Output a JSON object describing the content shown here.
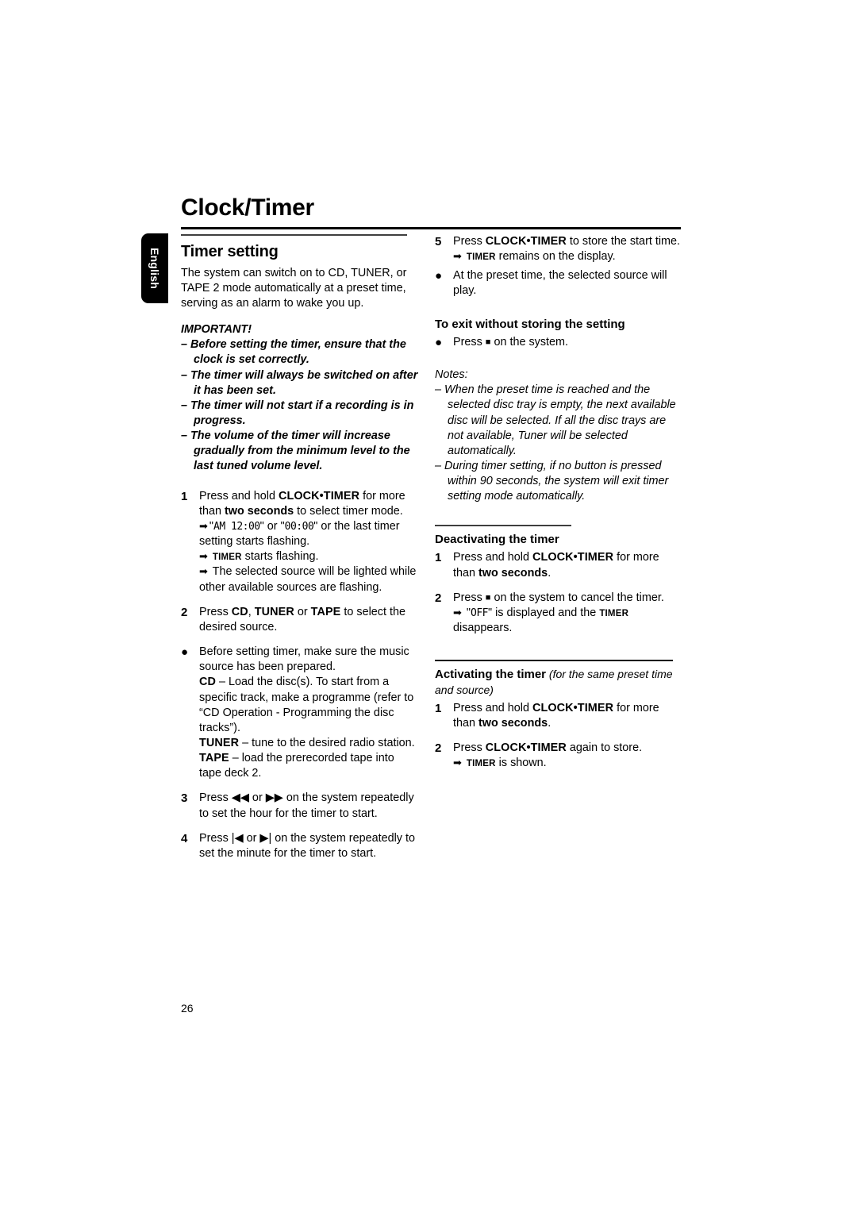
{
  "page": {
    "chapter_title": "Clock/Timer",
    "language_tab": "English",
    "page_number": "26"
  },
  "left_column": {
    "section_heading": "Timer setting",
    "intro": "The system can switch on to CD, TUNER, or TAPE 2 mode automatically at a preset time, serving as an alarm to wake you up.",
    "important_label": "IMPORTANT!",
    "important_items": [
      "–  Before setting the timer, ensure that the clock is set correctly.",
      "–  The timer will always be switched on after it has been set.",
      "–  The timer will not start if a recording is in progress.",
      "–  The volume of the timer will increase gradually from the minimum level to the last tuned volume level."
    ],
    "steps": [
      {
        "num": "1",
        "line1_a": "Press and hold ",
        "line1_key": "CLOCK•TIMER",
        "line1_b": " for more than ",
        "line1_bold": "two seconds",
        "line1_c": " to select timer mode.",
        "arrow1_pre": "\"",
        "arrow1_lcd1": "AM  12:00",
        "arrow1_mid": "\" or \"",
        "arrow1_lcd2": "00:00",
        "arrow1_post": "\" or the last timer setting starts flashing.",
        "arrow2_caps": "TIMER",
        "arrow2_text": " starts flashing.",
        "arrow3_text": "The selected source will be lighted while other available sources are flashing."
      },
      {
        "num": "2",
        "pre": "Press ",
        "key1": "CD",
        "sep1": ", ",
        "key2": "TUNER",
        "sep2": " or ",
        "key3": "TAPE",
        "post": " to select the desired source."
      },
      {
        "num": "●",
        "line1": "Before setting timer, make sure the music source has been prepared.",
        "cd_key": "CD",
        "cd_text": " – Load the disc(s). To start from a specific track, make a programme (refer to “CD Operation - Programming the disc tracks”).",
        "tuner_key": "TUNER",
        "tuner_text": " – tune to the desired radio station.",
        "tape_key": "TAPE",
        "tape_text": " – load the prerecorded tape into tape deck 2."
      },
      {
        "num": "3",
        "pre": "Press ",
        "icon1": "◀◀",
        "mid": " or ",
        "icon2": "▶▶",
        "post": "  on the system repeatedly to set the hour for the timer to start."
      },
      {
        "num": "4",
        "pre": "Press ",
        "icon1": "|◀",
        "mid": " or ",
        "icon2": "▶|",
        "post": " on the system repeatedly to set the minute for the timer to start."
      }
    ]
  },
  "right_column": {
    "step5": {
      "num": "5",
      "pre": "Press ",
      "key": "CLOCK•TIMER",
      "post": " to store the start time.",
      "arrow_caps": "TIMER",
      "arrow_text": " remains on the display."
    },
    "bullet_preset": {
      "num": "●",
      "text": "At the preset time, the selected source will play."
    },
    "exit_heading": "To exit without storing the setting",
    "exit_bullet": {
      "num": "●",
      "pre": "Press ",
      "icon": "■",
      "post": " on the system."
    },
    "notes_label": "Notes:",
    "notes": [
      "–  When the preset time is reached and the selected disc tray is empty, the next available disc will be selected.  If all the disc trays are not available, Tuner will be selected automatically.",
      "–  During timer setting, if no button is pressed within 90 seconds, the system will exit timer setting mode automatically."
    ],
    "deactivating_heading": "Deactivating the timer",
    "deactivating_steps": [
      {
        "num": "1",
        "pre": "Press and hold ",
        "key": "CLOCK•TIMER",
        "mid": " for more than ",
        "bold": "two seconds",
        "post": "."
      },
      {
        "num": "2",
        "pre": "Press ",
        "icon": "■",
        "post": " on the system to cancel the timer.",
        "arrow_pre": "\"",
        "arrow_lcd": "OFF",
        "arrow_mid": "\" is displayed and the ",
        "arrow_caps": "TIMER",
        "arrow_post": " disappears."
      }
    ],
    "activating_heading": "Activating the timer",
    "activating_paren": " (for the same preset time and source)",
    "activating_steps": [
      {
        "num": "1",
        "pre": "Press and hold ",
        "key": "CLOCK•TIMER",
        "mid": " for more than ",
        "bold": "two seconds",
        "post": "."
      },
      {
        "num": "2",
        "pre": "Press ",
        "key": "CLOCK•TIMER",
        "post": " again to store.",
        "arrow_caps": "TIMER",
        "arrow_post": " is shown."
      }
    ]
  }
}
